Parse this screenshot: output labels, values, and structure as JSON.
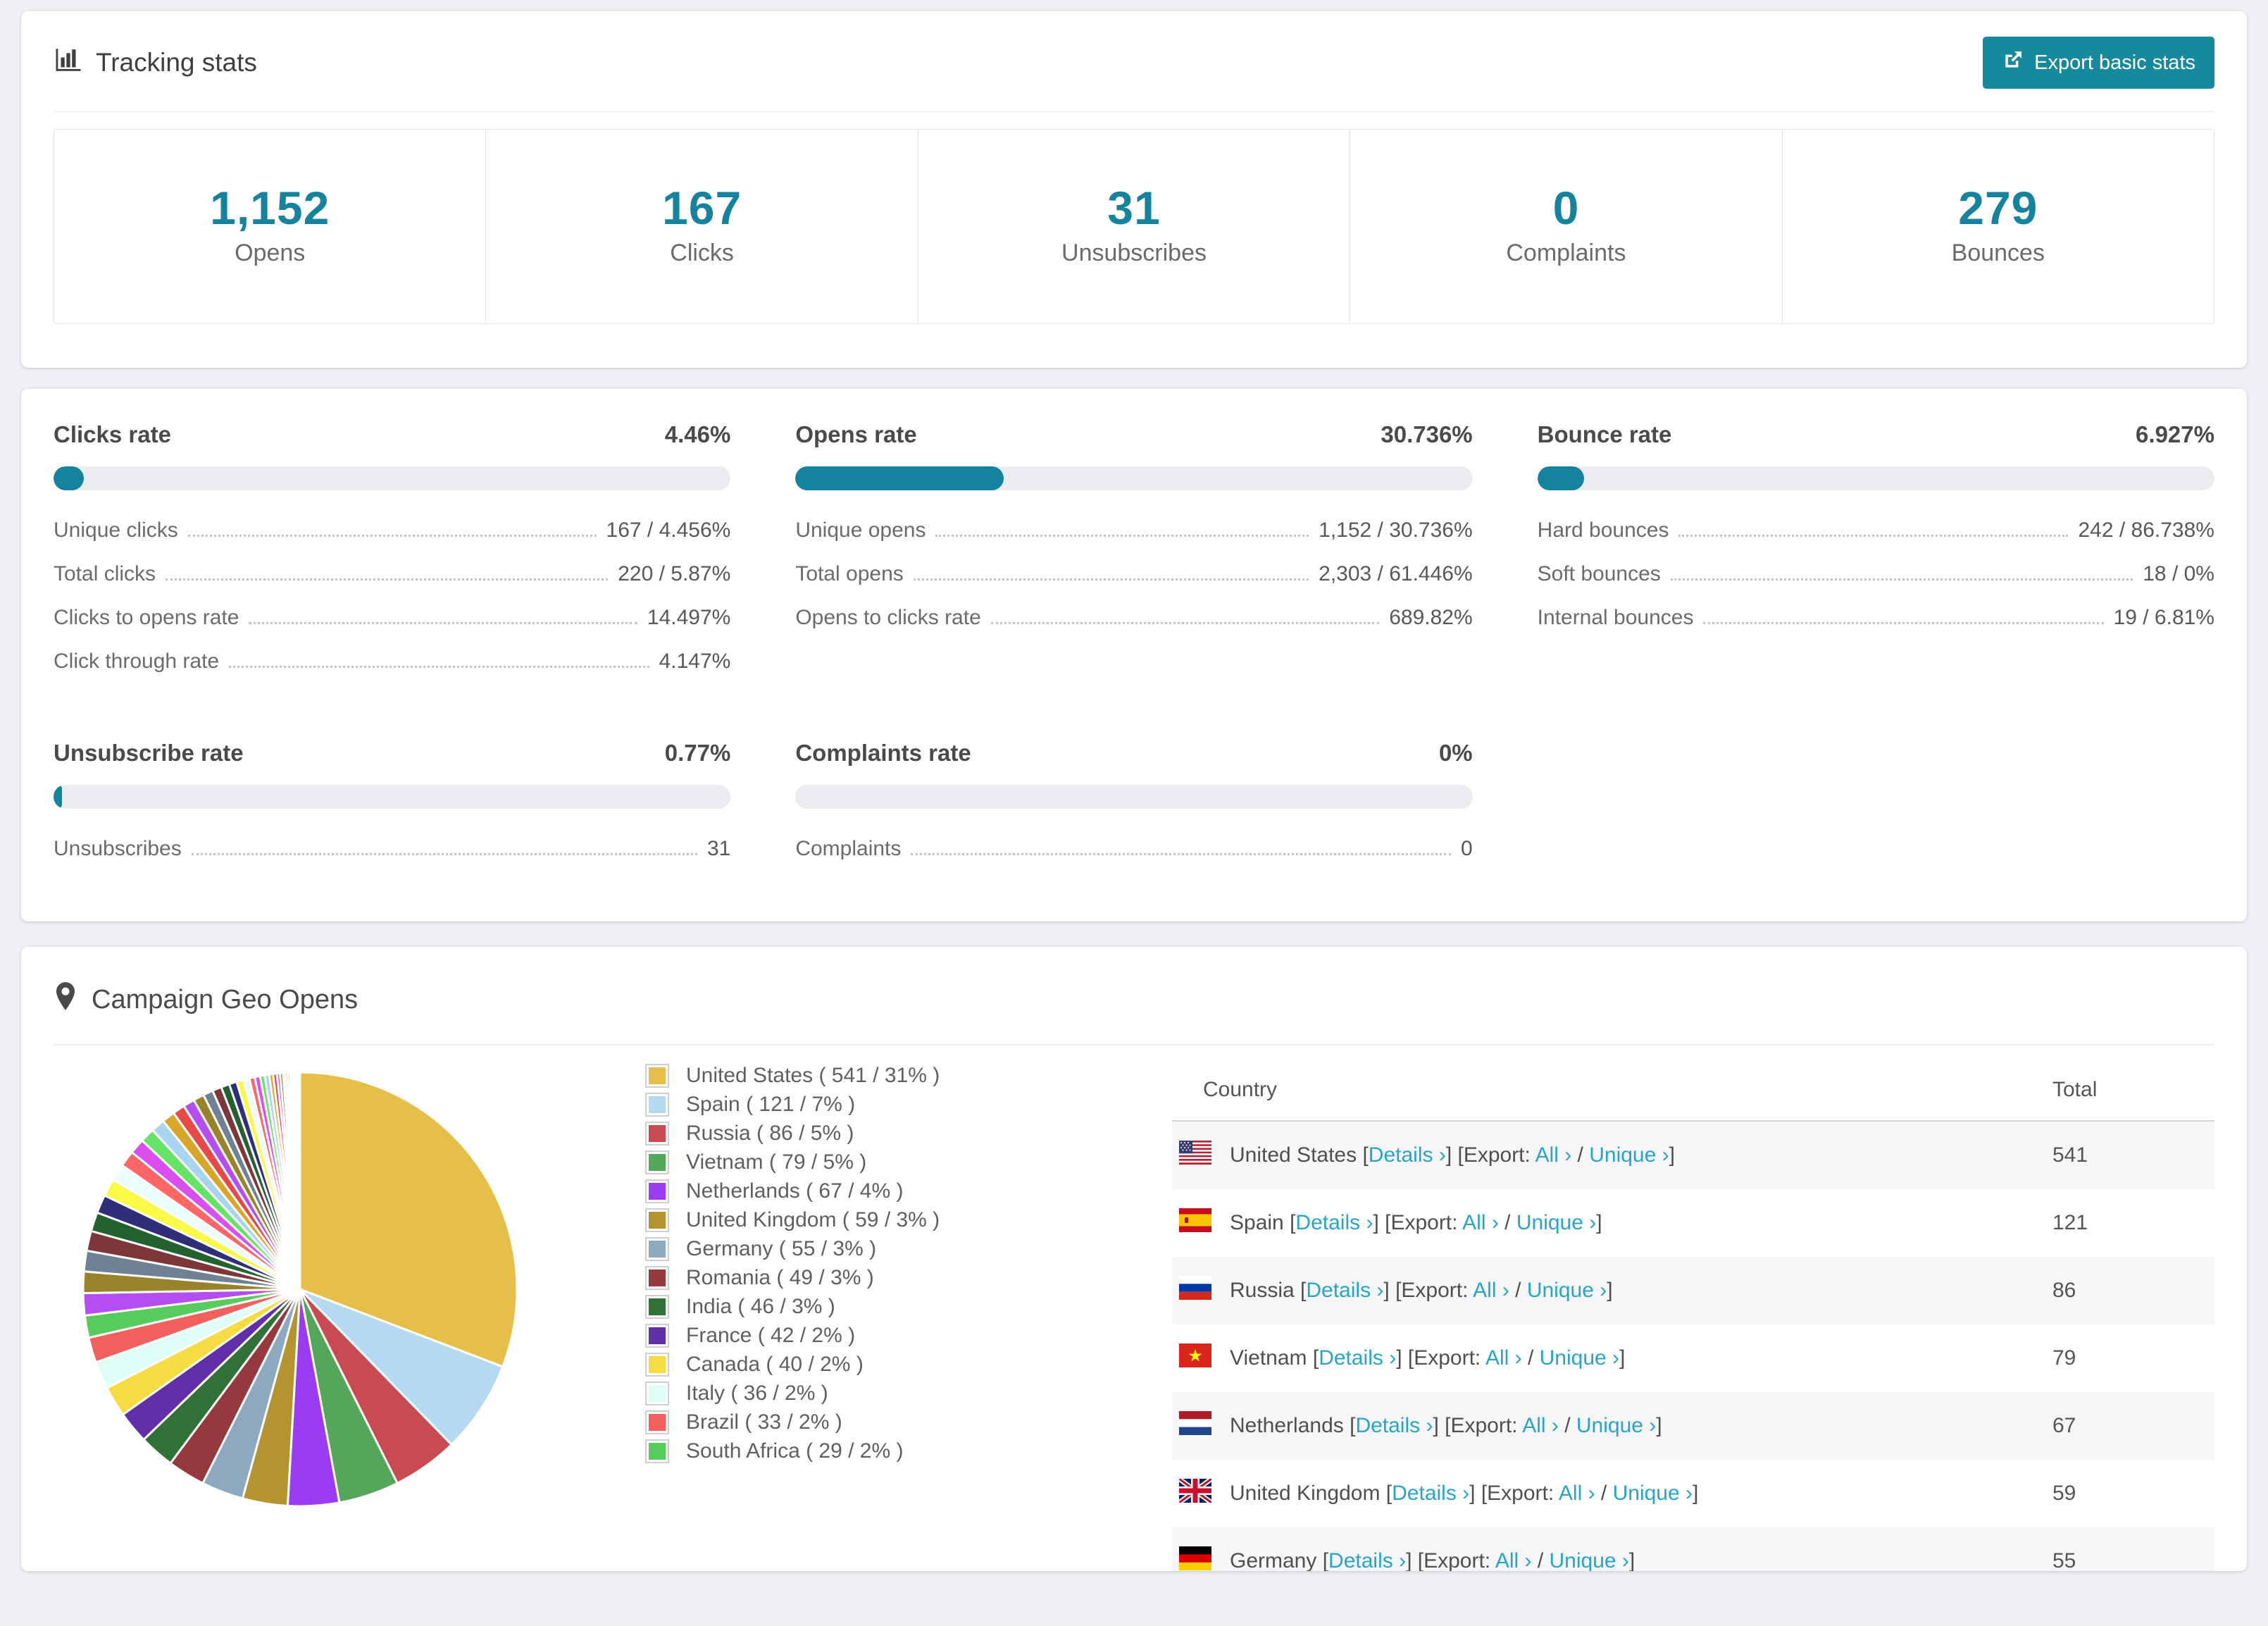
{
  "accent": "#15839e",
  "link_color": "#28a4c9",
  "icons": {
    "tracking": "bar-chart-icon",
    "export": "external-link-icon",
    "geo": "map-pin-icon"
  },
  "tracking": {
    "title": "Tracking stats",
    "export_label": "Export basic stats",
    "stats": [
      {
        "value": "1,152",
        "label": "Opens"
      },
      {
        "value": "167",
        "label": "Clicks"
      },
      {
        "value": "31",
        "label": "Unsubscribes"
      },
      {
        "value": "0",
        "label": "Complaints"
      },
      {
        "value": "279",
        "label": "Bounces"
      }
    ]
  },
  "rates": [
    {
      "title": "Clicks rate",
      "percent": "4.46%",
      "bar_pct": 4.46,
      "rows": [
        {
          "label": "Unique clicks",
          "value": "167 / 4.456%"
        },
        {
          "label": "Total clicks",
          "value": "220 / 5.87%"
        },
        {
          "label": "Clicks to opens rate",
          "value": "14.497%"
        },
        {
          "label": "Click through rate",
          "value": "4.147%"
        }
      ]
    },
    {
      "title": "Opens rate",
      "percent": "30.736%",
      "bar_pct": 30.736,
      "rows": [
        {
          "label": "Unique opens",
          "value": "1,152 / 30.736%"
        },
        {
          "label": "Total opens",
          "value": "2,303 / 61.446%"
        },
        {
          "label": "Opens to clicks rate",
          "value": "689.82%"
        }
      ]
    },
    {
      "title": "Bounce rate",
      "percent": "6.927%",
      "bar_pct": 6.927,
      "rows": [
        {
          "label": "Hard bounces",
          "value": "242 / 86.738%"
        },
        {
          "label": "Soft bounces",
          "value": "18 / 0%"
        },
        {
          "label": "Internal bounces",
          "value": "19 / 6.81%"
        }
      ]
    },
    {
      "title": "Unsubscribe rate",
      "percent": "0.77%",
      "bar_pct": 0.77,
      "rows": [
        {
          "label": "Unsubscribes",
          "value": "31"
        }
      ]
    },
    {
      "title": "Complaints rate",
      "percent": "0%",
      "bar_pct": 0,
      "rows": [
        {
          "label": "Complaints",
          "value": "0"
        }
      ]
    }
  ],
  "geo": {
    "title": "Campaign Geo Opens",
    "table": {
      "headers": [
        "Country",
        "Total"
      ],
      "links": {
        "details": "Details ›",
        "export_prefix": "Export:",
        "all": "All ›",
        "unique": "Unique ›"
      },
      "rows": [
        {
          "country": "United States",
          "flag": "us",
          "total": "541"
        },
        {
          "country": "Spain",
          "flag": "es",
          "total": "121"
        },
        {
          "country": "Russia",
          "flag": "ru",
          "total": "86"
        },
        {
          "country": "Vietnam",
          "flag": "vn",
          "total": "79"
        },
        {
          "country": "Netherlands",
          "flag": "nl",
          "total": "67"
        },
        {
          "country": "United Kingdom",
          "flag": "gb",
          "total": "59"
        },
        {
          "country": "Germany",
          "flag": "de",
          "total": "55",
          "partially_visible": true
        }
      ]
    }
  },
  "chart_data": {
    "type": "pie",
    "title": "Campaign Geo Opens",
    "unit": "opens",
    "legend_position": "right-of-pie",
    "legend_format": "{label} ( {value} / {pct} )",
    "slices": [
      {
        "label": "United States",
        "value": 541,
        "pct": "31%",
        "color": "#E6BE4A"
      },
      {
        "label": "Spain",
        "value": 121,
        "pct": "7%",
        "color": "#B6D9F2"
      },
      {
        "label": "Russia",
        "value": 86,
        "pct": "5%",
        "color": "#C74B50"
      },
      {
        "label": "Vietnam",
        "value": 79,
        "pct": "5%",
        "color": "#54A65B"
      },
      {
        "label": "Netherlands",
        "value": 67,
        "pct": "4%",
        "color": "#9B3BF2"
      },
      {
        "label": "United Kingdom",
        "value": 59,
        "pct": "3%",
        "color": "#B3942F"
      },
      {
        "label": "Germany",
        "value": 55,
        "pct": "3%",
        "color": "#8CA9C0"
      },
      {
        "label": "Romania",
        "value": 49,
        "pct": "3%",
        "color": "#95393E"
      },
      {
        "label": "India",
        "value": 46,
        "pct": "3%",
        "color": "#2F7136"
      },
      {
        "label": "France",
        "value": 42,
        "pct": "2%",
        "color": "#6130A8"
      },
      {
        "label": "Canada",
        "value": 40,
        "pct": "2%",
        "color": "#F6DB42"
      },
      {
        "label": "Italy",
        "value": 36,
        "pct": "2%",
        "color": "#DFFCF7"
      },
      {
        "label": "Brazil",
        "value": 33,
        "pct": "2%",
        "color": "#F2605D"
      },
      {
        "label": "South Africa",
        "value": 29,
        "pct": "2%",
        "color": "#58CB5E"
      }
    ],
    "unlabeled_slices_estimated": [
      29,
      28,
      27,
      26,
      25,
      24,
      23,
      22,
      21,
      20,
      19,
      18,
      17,
      16,
      15,
      14,
      13,
      12,
      11,
      10,
      9,
      8,
      7,
      7,
      6,
      6,
      5,
      5,
      4,
      4,
      3,
      3,
      3,
      2,
      2,
      2,
      2,
      1,
      1,
      1,
      1,
      1
    ],
    "small_slice_palette": [
      "#B44DF2",
      "#99832A",
      "#6E8294",
      "#7E3639",
      "#236230",
      "#2F2E78",
      "#F9F948",
      "#EAFFFB",
      "#FF6666",
      "#DC4DF0",
      "#66E366",
      "#A8D4F0",
      "#D7A62B",
      "#E84848"
    ]
  }
}
